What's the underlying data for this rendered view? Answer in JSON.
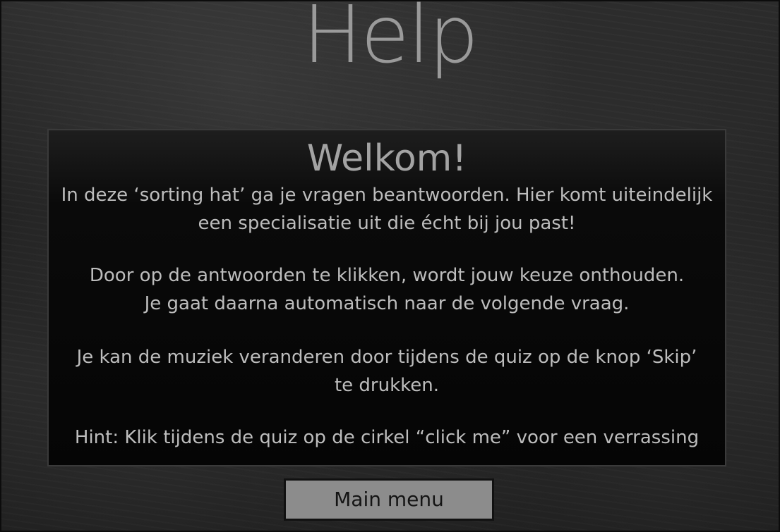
{
  "page": {
    "title": "Help"
  },
  "panel": {
    "heading": "Welkom!",
    "paragraphs": [
      [
        "In deze ‘sorting hat’ ga je vragen beantwoorden. Hier komt uiteindelijk",
        "een specialisatie uit die écht bij jou past!"
      ],
      [
        "Door op de antwoorden te klikken, wordt jouw keuze onthouden.",
        "Je gaat daarna automatisch naar de volgende vraag."
      ],
      [
        "Je kan de muziek veranderen door tijdens de quiz op de knop ‘Skip’",
        "te drukken."
      ],
      [
        "Hint: Klik tijdens de quiz op de cirkel “click me” voor een verrassing"
      ]
    ]
  },
  "footer": {
    "main_menu_label": "Main menu"
  },
  "colors": {
    "title": "#9a9a9a",
    "body_text": "#bdbdbd",
    "button_bg": "#8c8c8c",
    "panel_bg": "#050505"
  }
}
